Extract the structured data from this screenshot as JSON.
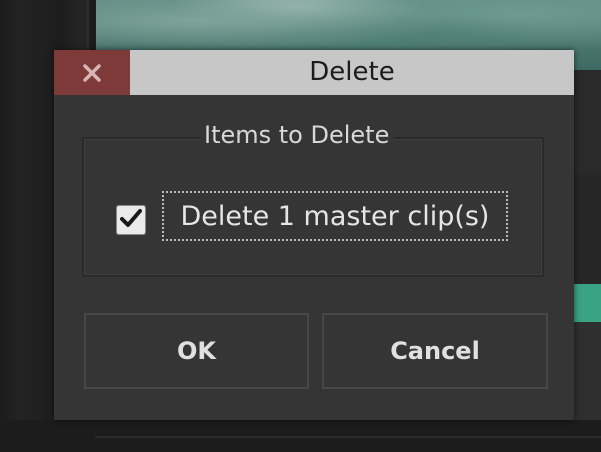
{
  "dialog": {
    "title": "Delete",
    "close_icon": "close-icon"
  },
  "group": {
    "legend": "Items to Delete"
  },
  "checkbox": {
    "checked": true,
    "label": "Delete 1 master clip(s)",
    "icon": "checkmark-icon"
  },
  "buttons": {
    "ok": "OK",
    "cancel": "Cancel"
  },
  "colors": {
    "close_button": "#7e3a39",
    "titlebar": "#c7c7c7",
    "dialog_bg": "#353535",
    "accent_teal": "#3aa384"
  }
}
